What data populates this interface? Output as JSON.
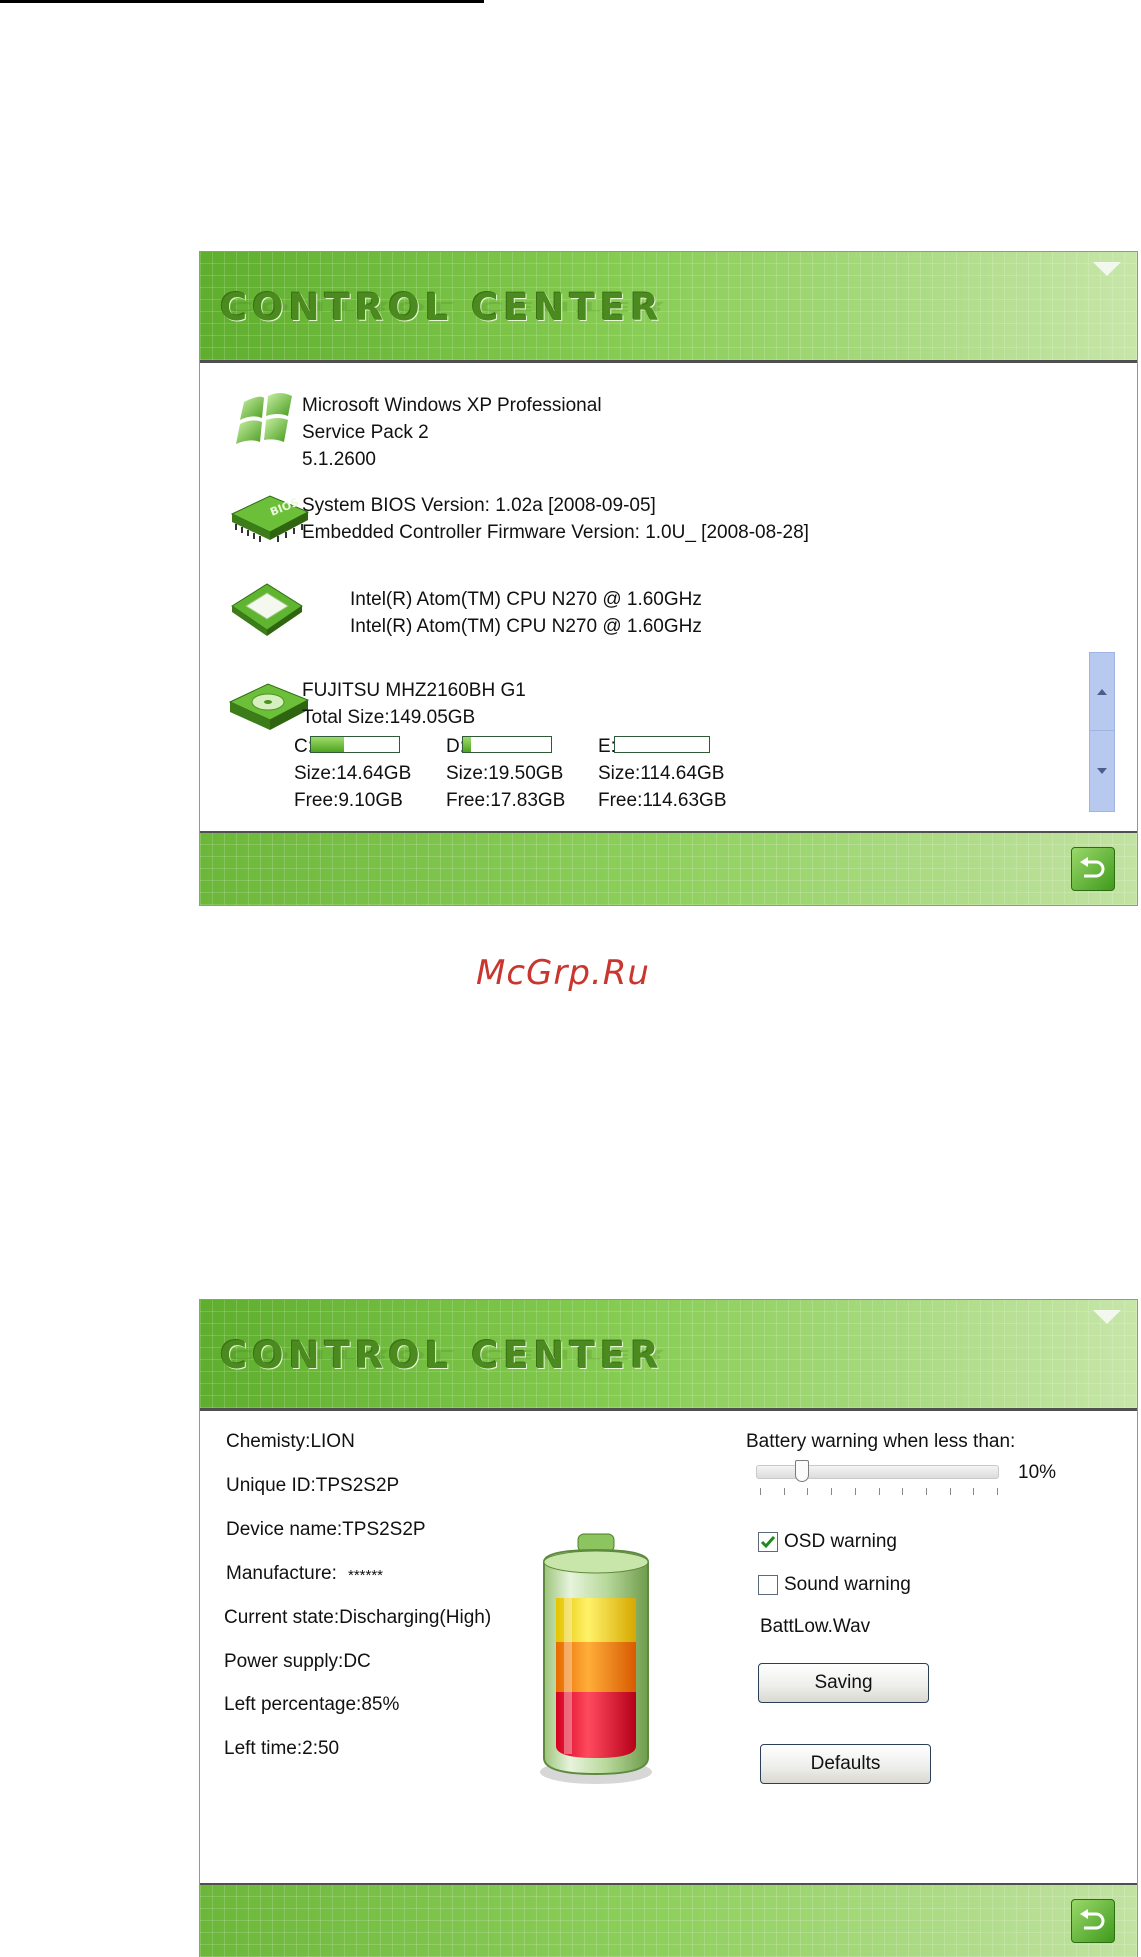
{
  "watermark": "McGrp.Ru",
  "window1": {
    "title": "CONTROL CENTER",
    "os": {
      "name": "Microsoft Windows XP Professional",
      "service_pack": "Service Pack 2",
      "version": "5.1.2600"
    },
    "bios": {
      "line1": "System BIOS Version: 1.02a   [2008-09-05]",
      "line2": "Embedded Controller Firmware Version: 1.0U_   [2008-08-28]"
    },
    "cpu": {
      "line1": "Intel(R) Atom(TM) CPU N270   @ 1.60GHz",
      "line2": "Intel(R) Atom(TM) CPU N270   @ 1.60GHz"
    },
    "disk": {
      "model": "FUJITSU MHZ2160BH G1",
      "total": "Total Size:149.05GB",
      "drives": [
        {
          "label": "C:",
          "size": "Size:14.64GB",
          "free": "Free:9.10GB",
          "used_fraction": 0.38
        },
        {
          "label": "D:",
          "size": "Size:19.50GB",
          "free": "Free:17.83GB",
          "used_fraction": 0.09
        },
        {
          "label": "E:",
          "size": "Size:114.64GB",
          "free": "Free:114.63GB",
          "used_fraction": 0.0
        }
      ]
    },
    "icons": [
      "windows-logo-icon",
      "bios-chip-icon",
      "cpu-chip-icon",
      "hard-drive-icon",
      "back-arrow-icon"
    ]
  },
  "window2": {
    "title": "CONTROL CENTER",
    "battery_info": {
      "chemistry": "Chemisty:LION",
      "unique_id": "Unique ID:TPS2S2P",
      "device_name": "Device name:TPS2S2P",
      "manufacture_label": "Manufacture:",
      "manufacture_value": "******",
      "current_state": "Current state:Discharging(High)",
      "power_supply": "Power supply:DC",
      "left_percentage": "Left percentage:85%",
      "left_time": "Left time:2:50"
    },
    "warning": {
      "label": "Battery warning when less than:",
      "value_text": "10%",
      "level_fraction": 0.1,
      "osd_label": "OSD warning",
      "osd_checked": true,
      "sound_label": "Sound warning",
      "sound_checked": false,
      "sound_file": "BattLow.Wav",
      "saving_label": "Saving",
      "defaults_label": "Defaults"
    }
  },
  "colors": {
    "header_green": "#7cc448",
    "accent_dark": "#4f4f4f",
    "scroll_blue": "#b7c9ef",
    "watermark_red": "#c8362f"
  }
}
